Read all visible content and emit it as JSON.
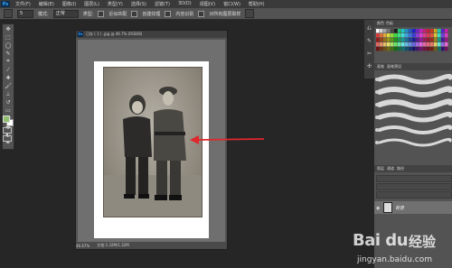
{
  "app": {
    "logo": "Ps"
  },
  "menu": [
    "文件(F)",
    "编辑(E)",
    "图像(I)",
    "图层(L)",
    "类型(Y)",
    "选择(S)",
    "滤镜(T)",
    "3D(D)",
    "视图(V)",
    "窗口(W)",
    "帮助(H)"
  ],
  "options": {
    "size": "5",
    "mode_label": "模式:",
    "mode_value": "正常",
    "type_label": "类型:",
    "type_option": "近似匹配",
    "proximity_option": "创建纹理",
    "content_aware": "内容识别",
    "sample_all": "对所有图层取样"
  },
  "document": {
    "tab_title": "已存 ( 1 ) .jpg @ 46.7% (RGB/8)",
    "zoom": "46.67%",
    "doc_size": "文档:1.32M/1.32M"
  },
  "panels": {
    "swatch_tabs": [
      "颜色",
      "色板"
    ],
    "brush_tabs": [
      "画笔",
      "画笔预设"
    ],
    "layers_tabs": [
      "图层",
      "通道",
      "路径"
    ],
    "layer_name": "背景"
  },
  "colors": {
    "foreground": "#8fbf6e",
    "background": "#ffffff",
    "arrow": "#e0272b"
  },
  "watermark": {
    "brand": "Bai du",
    "cn": "经验",
    "url": "jingyan.baidu.com"
  }
}
